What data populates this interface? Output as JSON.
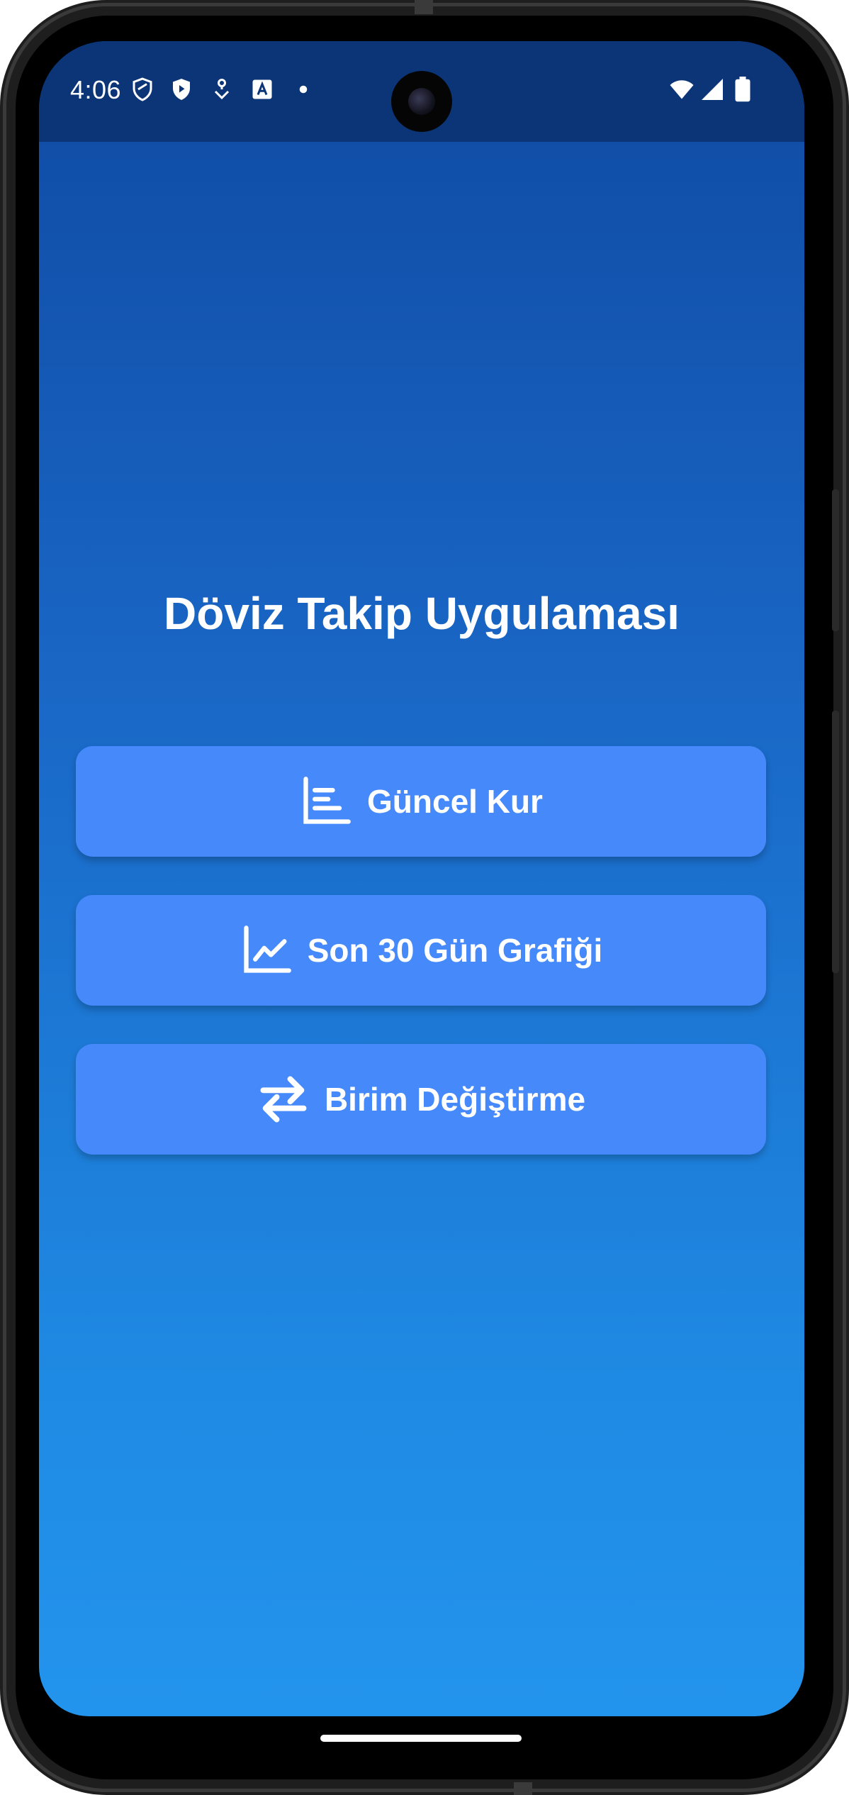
{
  "status_bar": {
    "time": "4:06",
    "left_icons": [
      "shield-icon",
      "play-shield-icon",
      "location-pin-icon",
      "translate-icon",
      "dot-icon"
    ],
    "right_icons": [
      "wifi-icon",
      "signal-icon",
      "battery-icon"
    ]
  },
  "app": {
    "title": "Döviz Takip Uygulaması",
    "buttons": [
      {
        "label": "Güncel Kur",
        "icon": "bar-list-icon"
      },
      {
        "label": "Son 30 Gün Grafiği",
        "icon": "line-chart-icon"
      },
      {
        "label": "Birim Değiştirme",
        "icon": "swap-arrows-icon"
      }
    ]
  },
  "colors": {
    "status_bar_bg": "#0b3577",
    "gradient_top": "#0f4aa3",
    "gradient_bottom": "#2394ed",
    "button_bg": "#4589fb",
    "text": "#ffffff"
  }
}
